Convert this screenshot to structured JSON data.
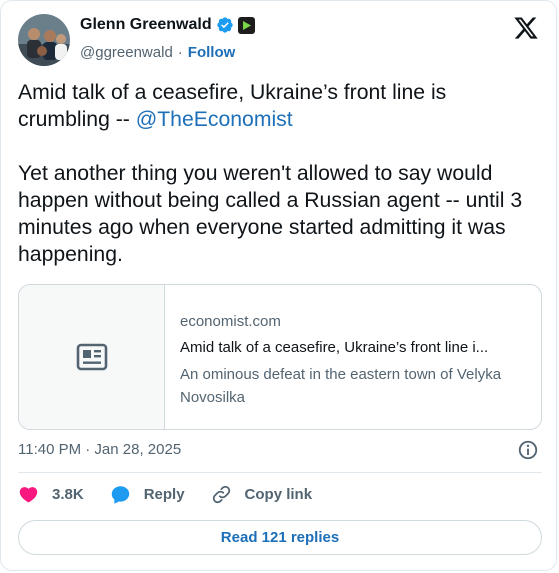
{
  "author": {
    "name": "Glenn Greenwald",
    "handle": "@ggreenwald",
    "follow_label": "Follow",
    "separator": "·"
  },
  "tweet": {
    "line1_prefix": "Amid talk of a ceasefire, Ukraine’s front line is crumbling -- ",
    "mention": "@TheEconomist",
    "paragraph2": "Yet another thing you weren't allowed to say would happen without being called a Russian agent -- until 3 minutes ago when everyone started admitting it was happening."
  },
  "link_card": {
    "domain": "economist.com",
    "title": "Amid talk of a ceasefire, Ukraine’s front line i...",
    "description": "An ominous defeat in the eastern town of Velyka Novosilka",
    "thumb_icon": "newspaper-icon"
  },
  "timestamp": "11:40 PM · Jan 28, 2025",
  "actions": {
    "likes": "3.8K",
    "reply_label": "Reply",
    "copy_link_label": "Copy link"
  },
  "read_replies_label": "Read 121 replies",
  "colors": {
    "accent": "#1d6fb8",
    "like": "#f91880",
    "reply": "#1d9bf0",
    "muted": "#536471"
  }
}
